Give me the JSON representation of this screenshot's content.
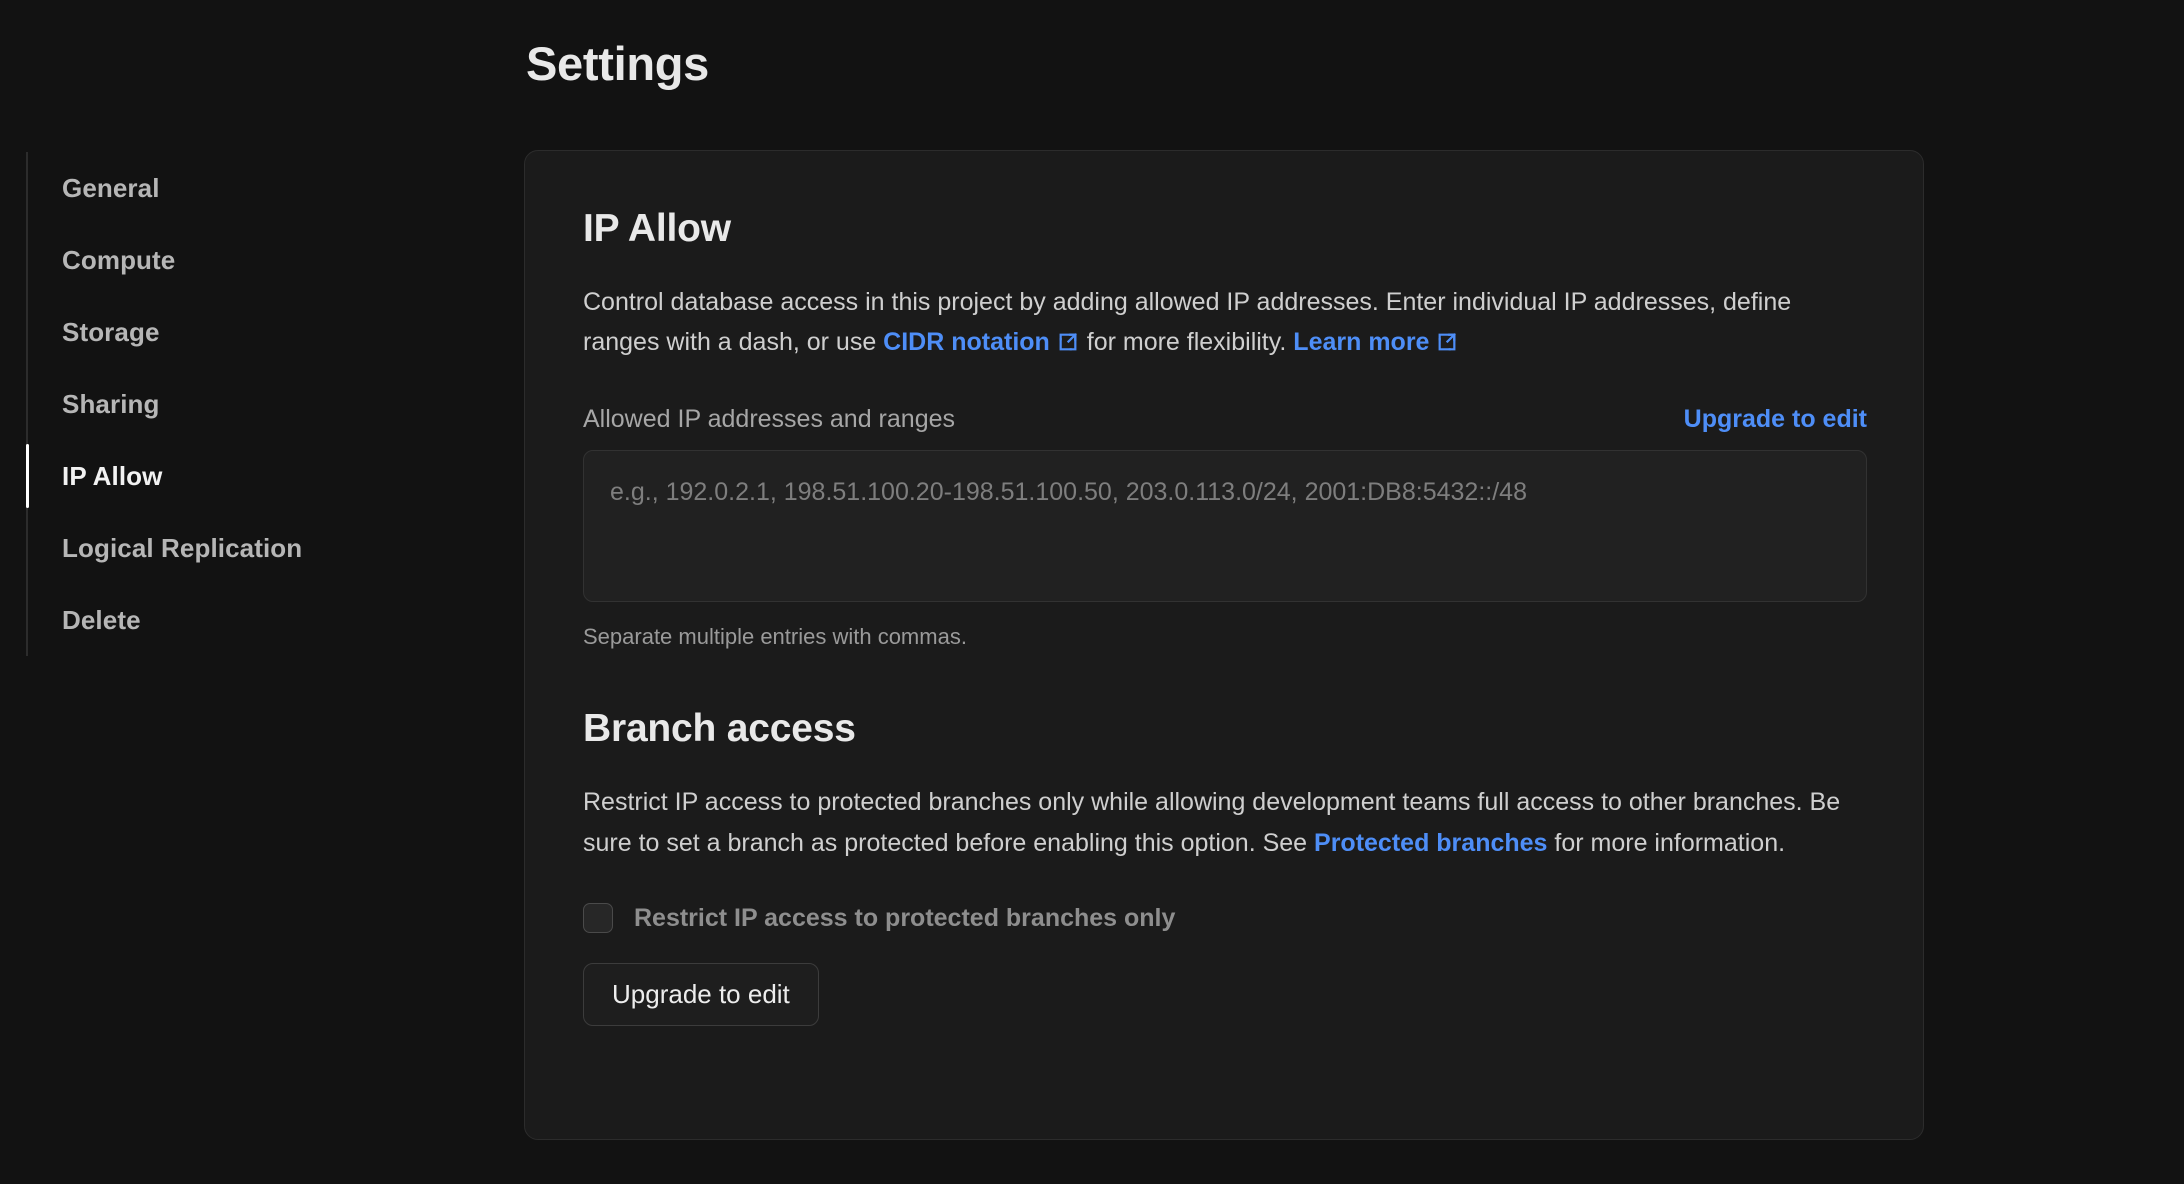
{
  "header": {
    "title": "Settings"
  },
  "sidebar": {
    "items": [
      {
        "label": "General",
        "active": false
      },
      {
        "label": "Compute",
        "active": false
      },
      {
        "label": "Storage",
        "active": false
      },
      {
        "label": "Sharing",
        "active": false
      },
      {
        "label": "IP Allow",
        "active": true
      },
      {
        "label": "Logical Replication",
        "active": false
      },
      {
        "label": "Delete",
        "active": false
      }
    ]
  },
  "ip_allow": {
    "heading": "IP Allow",
    "description_part1": "Control database access in this project by adding allowed IP addresses. Enter individual IP addresses, define ranges with a dash, or use ",
    "cidr_link": "CIDR notation",
    "description_part2": " for more flexibility. ",
    "learn_more_link": "Learn more",
    "field_label": "Allowed IP addresses and ranges",
    "upgrade_link": "Upgrade to edit",
    "textarea_value": "",
    "textarea_placeholder": "e.g., 192.0.2.1, 198.51.100.20-198.51.100.50, 203.0.113.0/24, 2001:DB8:5432::/48",
    "helper_text": "Separate multiple entries with commas."
  },
  "branch_access": {
    "heading": "Branch access",
    "description_part1": "Restrict IP access to protected branches only while allowing development teams full access to other branches. Be sure to set a branch as protected before enabling this option. See ",
    "protected_branches_link": "Protected branches",
    "description_part2": " for more information.",
    "checkbox_label": "Restrict IP access to protected branches only",
    "checkbox_checked": false,
    "button_label": "Upgrade to edit"
  },
  "icons": {
    "external_link": "external-link-icon"
  },
  "colors": {
    "page_background": "#121212",
    "card_background": "#1b1b1b",
    "card_border": "#2c2c2c",
    "link_accent": "#4e8ef7",
    "active_indicator": "#ffffff",
    "text_primary": "#e9e9e9",
    "text_secondary": "#cfcfcf",
    "text_muted": "#8e8e8e"
  }
}
